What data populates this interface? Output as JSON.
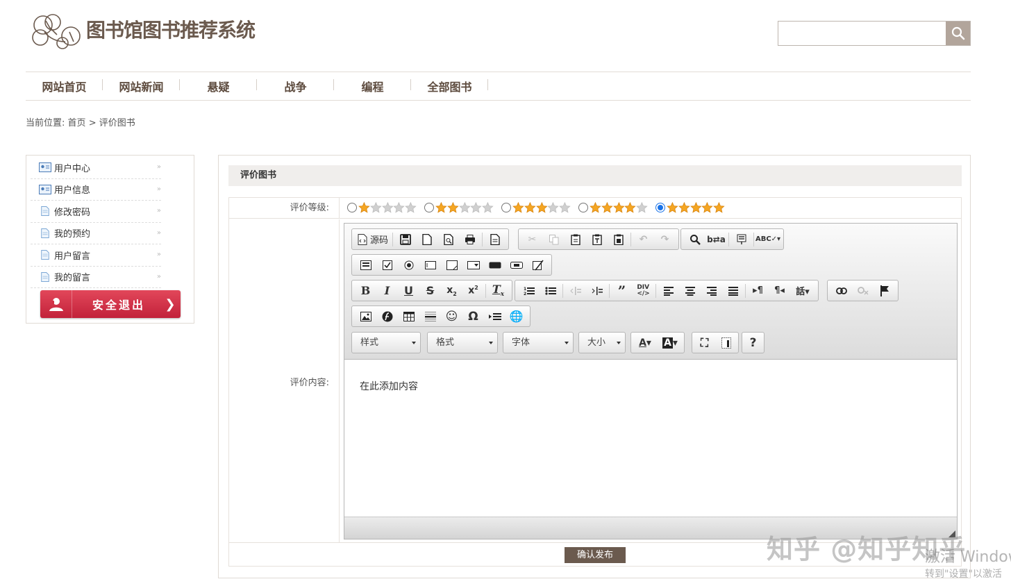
{
  "header": {
    "site_title": "图书馆图书推荐系统",
    "search": {
      "placeholder": "",
      "value": ""
    }
  },
  "nav": {
    "items": [
      "网站首页",
      "网站新闻",
      "悬疑",
      "战争",
      "编程",
      "全部图书"
    ]
  },
  "breadcrumb": {
    "prefix": "当前位置:",
    "home": "首页",
    "separator": ">",
    "current": "评价图书"
  },
  "sidebar": {
    "items": [
      "用户中心",
      "用户信息",
      "修改密码",
      "我的预约",
      "用户留言",
      "我的留言"
    ],
    "logout_label": "安全退出"
  },
  "main": {
    "panel_title": "评价图书",
    "rating": {
      "label": "评价等级:",
      "options": [
        1,
        2,
        3,
        4,
        5
      ],
      "max": 5,
      "selected": 5
    },
    "content": {
      "label": "评价内容:",
      "placeholder_text": "在此添加内容"
    },
    "editor": {
      "source_label": "源码",
      "combos": [
        "样式",
        "格式",
        "字体",
        "大小"
      ],
      "help_label": "?"
    },
    "submit_label": "确认发布"
  },
  "watermarks": {
    "zhihu": "知乎 @知乎知乎",
    "activate_line1": "激活 Windows",
    "activate_line2": "转到\"设置\"以激活"
  },
  "colors": {
    "brand_brown": "#6b5a4e",
    "logout_red": "#c2223a",
    "star_gold": "#f5a623",
    "star_empty": "#d0d0d0",
    "radio_blue": "#1a73e8"
  }
}
